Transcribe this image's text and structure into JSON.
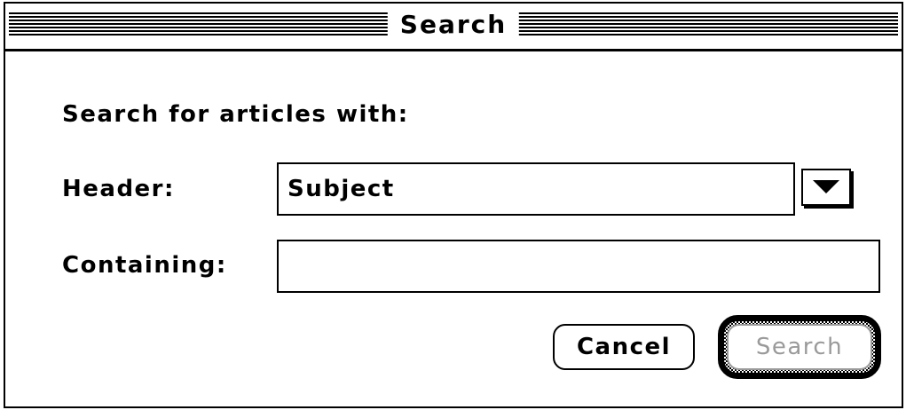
{
  "window": {
    "title": "Search"
  },
  "form": {
    "prompt": "Search for articles with:",
    "header_label": "Header:",
    "header_value": "Subject",
    "containing_label": "Containing:",
    "containing_value": "",
    "containing_placeholder": ""
  },
  "buttons": {
    "cancel_label": "Cancel",
    "search_label": "Search",
    "search_enabled": false,
    "search_default": true
  },
  "icons": {
    "dropdown": "triangle-down-icon"
  },
  "colors": {
    "foreground": "#000000",
    "background": "#ffffff",
    "disabled_text": "#9a9a9a"
  }
}
